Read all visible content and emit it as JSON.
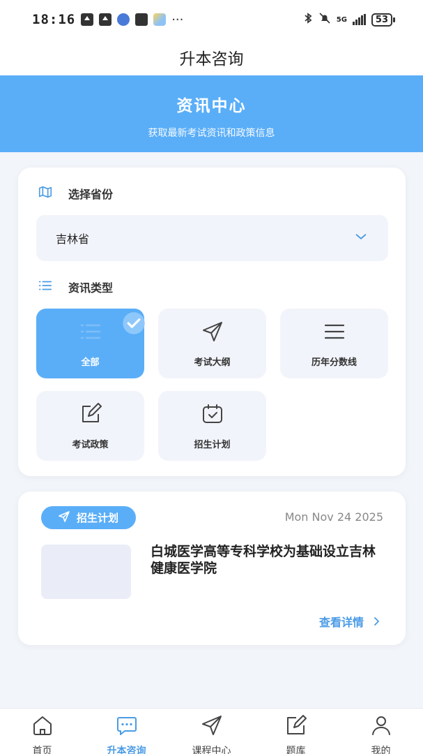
{
  "status_bar": {
    "time": "18:16",
    "dots": "···",
    "network": "5G",
    "battery": "53"
  },
  "nav": {
    "title": "升本咨询"
  },
  "banner": {
    "title": "资讯中心",
    "subtitle": "获取最新考试资讯和政策信息"
  },
  "filters": {
    "province_label": "选择省份",
    "province_value": "吉林省",
    "type_label": "资讯类型",
    "types": [
      {
        "label": "全部",
        "icon": "list-icon",
        "active": true
      },
      {
        "label": "考试大纲",
        "icon": "send-icon",
        "active": false
      },
      {
        "label": "历年分数线",
        "icon": "menu-icon",
        "active": false
      },
      {
        "label": "考试政策",
        "icon": "edit-icon",
        "active": false
      },
      {
        "label": "招生计划",
        "icon": "calendar-check-icon",
        "active": false
      }
    ]
  },
  "news": [
    {
      "tag": "招生计划",
      "date": "Mon Nov 24 2025",
      "title": "白城医学高等专科学校为基础设立吉林健康医学院",
      "more": "查看详情"
    }
  ],
  "tabs": [
    {
      "label": "首页",
      "icon": "home-icon",
      "active": false
    },
    {
      "label": "升本咨询",
      "icon": "chat-icon",
      "active": true
    },
    {
      "label": "课程中心",
      "icon": "send-icon",
      "active": false
    },
    {
      "label": "题库",
      "icon": "edit-icon",
      "active": false
    },
    {
      "label": "我的",
      "icon": "user-icon",
      "active": false
    }
  ],
  "colors": {
    "accent": "#5aaef8",
    "link": "#4a9be6",
    "bg": "#f2f5fa",
    "tile": "#f2f4fb"
  }
}
